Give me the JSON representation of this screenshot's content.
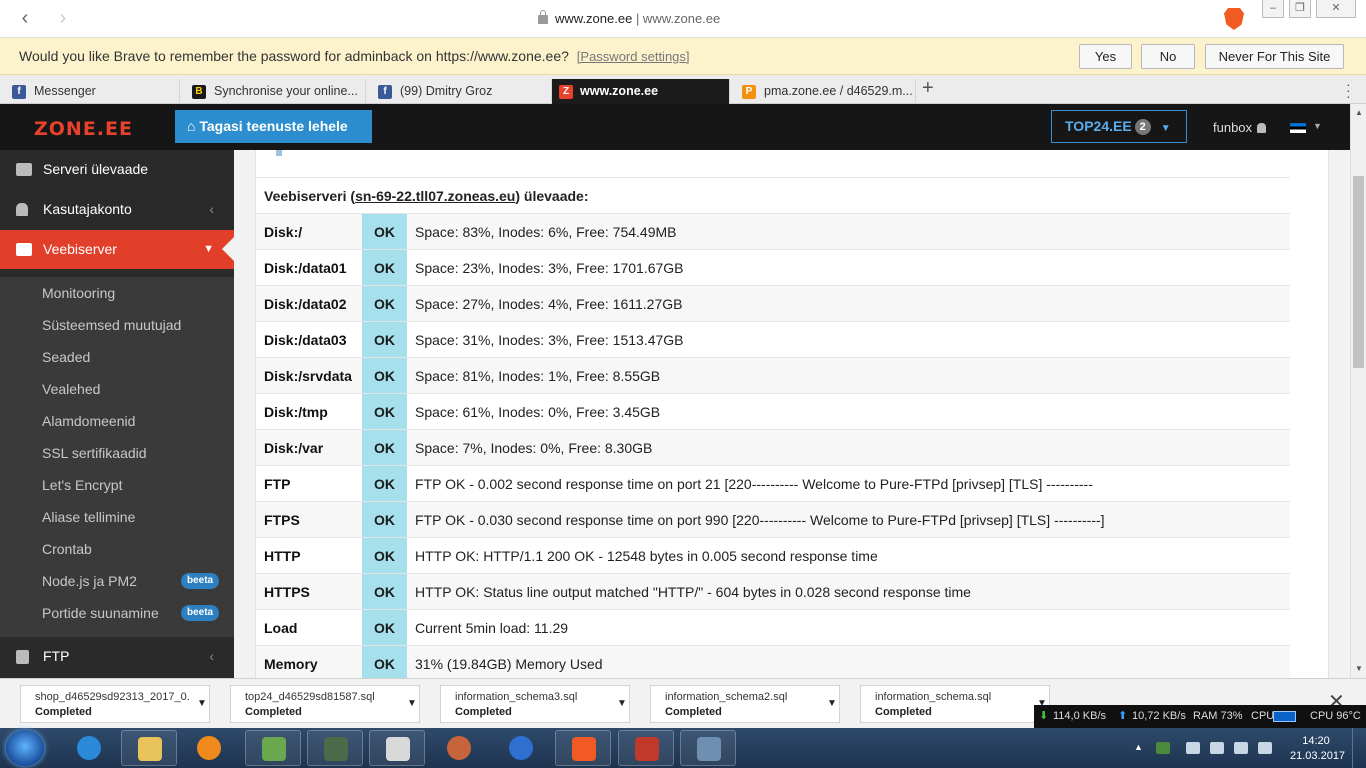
{
  "browser": {
    "url_host": "www.zone.ee",
    "url_rest": " | www.zone.ee",
    "window_controls": [
      "–",
      "❐",
      "✕"
    ]
  },
  "password_bar": {
    "message": "Would you like Brave to remember the password for adminback on https://www.zone.ee?",
    "settings_link": "[Password settings]",
    "yes": "Yes",
    "no": "No",
    "never": "Never For This Site"
  },
  "tabs": [
    {
      "label": "Messenger",
      "icon": "facebook-icon",
      "color": "#3b5998",
      "glyph": "f"
    },
    {
      "label": "Synchronise your online...",
      "icon": "bestbuy-icon",
      "color": "#1a1a1a",
      "glyph": "B"
    },
    {
      "label": "(99) Dmitry Groz",
      "icon": "facebook-icon",
      "color": "#3b5998",
      "glyph": "f"
    },
    {
      "label": "www.zone.ee",
      "icon": "zone-icon",
      "color": "#e8412c",
      "glyph": "Z"
    },
    {
      "label": "pma.zone.ee / d46529.m...",
      "icon": "phpmyadmin-icon",
      "color": "#f29111",
      "glyph": "P"
    }
  ],
  "header": {
    "logo": "ZONE.EE",
    "back_button": "Tagasi teenuste lehele",
    "top24_label": "TOP24.EE",
    "top24_count": "2",
    "user": "funbox"
  },
  "sidebar": {
    "main_items": [
      {
        "label": "Serveri ülevaade",
        "icon": "monitor-icon"
      },
      {
        "label": "Kasutajakonto",
        "icon": "user-icon"
      },
      {
        "label": "Veebiserver",
        "icon": "server-icon"
      }
    ],
    "sub_items": [
      {
        "label": "Monitooring"
      },
      {
        "label": "Süsteemsed muutujad"
      },
      {
        "label": "Seaded"
      },
      {
        "label": "Vealehed"
      },
      {
        "label": "Alamdomeenid"
      },
      {
        "label": "SSL sertifikaadid"
      },
      {
        "label": "Let's Encrypt"
      },
      {
        "label": "Aliase tellimine"
      },
      {
        "label": "Crontab"
      },
      {
        "label": "Node.js ja PM2",
        "badge": "beeta"
      },
      {
        "label": "Portide suunamine",
        "badge": "beeta"
      }
    ],
    "bottom_item": {
      "label": "FTP",
      "icon": "ftp-icon"
    }
  },
  "overview": {
    "caption_prefix": "Veebiserveri (",
    "server_link": "sn-69-22.tll07.zoneas.eu",
    "caption_suffix": ") ülevaade:",
    "rows": [
      {
        "name": "Disk:/",
        "status": "OK",
        "desc": "Space: 83%, Inodes: 6%, Free: 754.49MB"
      },
      {
        "name": "Disk:/data01",
        "status": "OK",
        "desc": "Space: 23%, Inodes: 3%, Free: 1701.67GB"
      },
      {
        "name": "Disk:/data02",
        "status": "OK",
        "desc": "Space: 27%, Inodes: 4%, Free: 1611.27GB"
      },
      {
        "name": "Disk:/data03",
        "status": "OK",
        "desc": "Space: 31%, Inodes: 3%, Free: 1513.47GB"
      },
      {
        "name": "Disk:/srvdata",
        "status": "OK",
        "desc": "Space: 81%, Inodes: 1%, Free: 8.55GB"
      },
      {
        "name": "Disk:/tmp",
        "status": "OK",
        "desc": "Space: 61%, Inodes: 0%, Free: 3.45GB"
      },
      {
        "name": "Disk:/var",
        "status": "OK",
        "desc": "Space: 7%, Inodes: 0%, Free: 8.30GB"
      },
      {
        "name": "FTP",
        "status": "OK",
        "desc": "FTP OK - 0.002 second response time on port 21 [220---------- Welcome to Pure-FTPd [privsep] [TLS] ----------"
      },
      {
        "name": "FTPS",
        "status": "OK",
        "desc": "FTP OK - 0.030 second response time on port 990 [220---------- Welcome to Pure-FTPd [privsep] [TLS] ----------]"
      },
      {
        "name": "HTTP",
        "status": "OK",
        "desc": "HTTP OK: HTTP/1.1 200 OK - 12548 bytes in 0.005 second response time"
      },
      {
        "name": "HTTPS",
        "status": "OK",
        "desc": "HTTP OK: Status line output matched \"HTTP/\" - 604 bytes in 0.028 second response time"
      },
      {
        "name": "Load",
        "status": "OK",
        "desc": "Current 5min load: 11.29"
      },
      {
        "name": "Memory",
        "status": "OK",
        "desc": "31% (19.84GB) Memory Used"
      }
    ]
  },
  "downloads": [
    {
      "name": "shop_d46529sd92313_2017_0...",
      "status": "Completed"
    },
    {
      "name": "top24_d46529sd81587.sql",
      "status": "Completed"
    },
    {
      "name": "information_schema3.sql",
      "status": "Completed"
    },
    {
      "name": "information_schema2.sql",
      "status": "Completed"
    },
    {
      "name": "information_schema.sql",
      "status": "Completed"
    }
  ],
  "netmeter": {
    "down": "114,0 KB/s",
    "up": "10,72 KB/s",
    "ram": "RAM 73%",
    "cpu": "CPU",
    "cpu_temp": "CPU 96°C"
  },
  "taskbar": {
    "time": "14:20",
    "date": "21.03.2017",
    "apps": [
      {
        "name": "ie-icon",
        "color": "#2a8ad9"
      },
      {
        "name": "explorer-icon",
        "color": "#e7c35a"
      },
      {
        "name": "media-player-icon",
        "color": "#f08a1c"
      },
      {
        "name": "notepad-icon",
        "color": "#6aa84f"
      },
      {
        "name": "terminal-icon",
        "color": "#4a6b4a"
      },
      {
        "name": "paint-icon",
        "color": "#d9d9d9"
      },
      {
        "name": "firewall-icon",
        "color": "#c8643a"
      },
      {
        "name": "browser-icon",
        "color": "#2f6fd0"
      },
      {
        "name": "brave-icon",
        "color": "#f15a22"
      },
      {
        "name": "filezilla-icon",
        "color": "#c0392b"
      },
      {
        "name": "photo-viewer-icon",
        "color": "#6f8fb0"
      }
    ]
  },
  "colors": {
    "accent_red": "#e23f2a",
    "accent_blue": "#2c8ecf",
    "status_ok": "#a6e0ec"
  }
}
